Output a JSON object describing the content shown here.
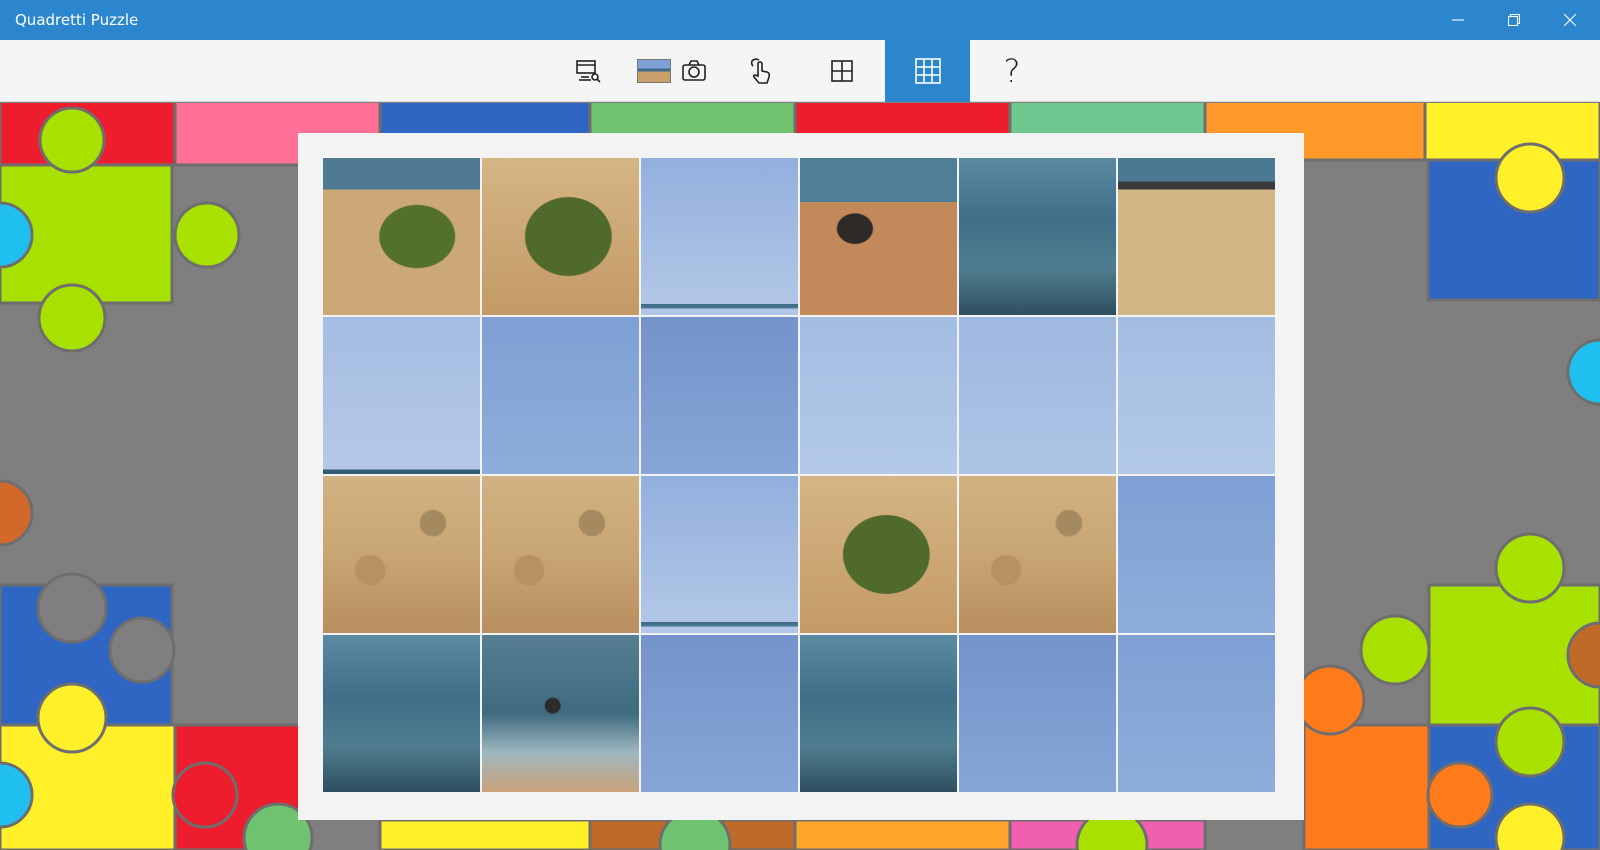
{
  "window": {
    "title": "Quadretti Puzzle"
  },
  "window_controls": {
    "minimize_icon": "minimize-icon",
    "maximize_icon": "restore-icon",
    "close_icon": "close-icon"
  },
  "toolbar": {
    "items": [
      {
        "icon": "gallery-search-icon"
      },
      {
        "icon": "image-thumbnail"
      },
      {
        "icon": "camera-icon"
      },
      {
        "icon": "touch-gesture-icon"
      },
      {
        "icon": "grid-2x2-icon"
      },
      {
        "icon": "grid-3x3-icon",
        "selected": true
      },
      {
        "icon": "help-icon",
        "glyph": "?"
      }
    ],
    "accent": "#2b86cd"
  },
  "board": {
    "columns": 6,
    "rows": 4,
    "tiles": [
      "bush-top",
      "bush",
      "sky-horizon",
      "rocks",
      "sea",
      "beach-top",
      "sky-horizon-low",
      "sky-b",
      "sky-c",
      "sky-a",
      "sky-d",
      "sky-a",
      "sand",
      "sand",
      "sky-horizon",
      "bush",
      "sand",
      "sky-b",
      "sea",
      "sea-rock",
      "sky-c",
      "sea",
      "sky-c",
      "sky-b"
    ]
  }
}
